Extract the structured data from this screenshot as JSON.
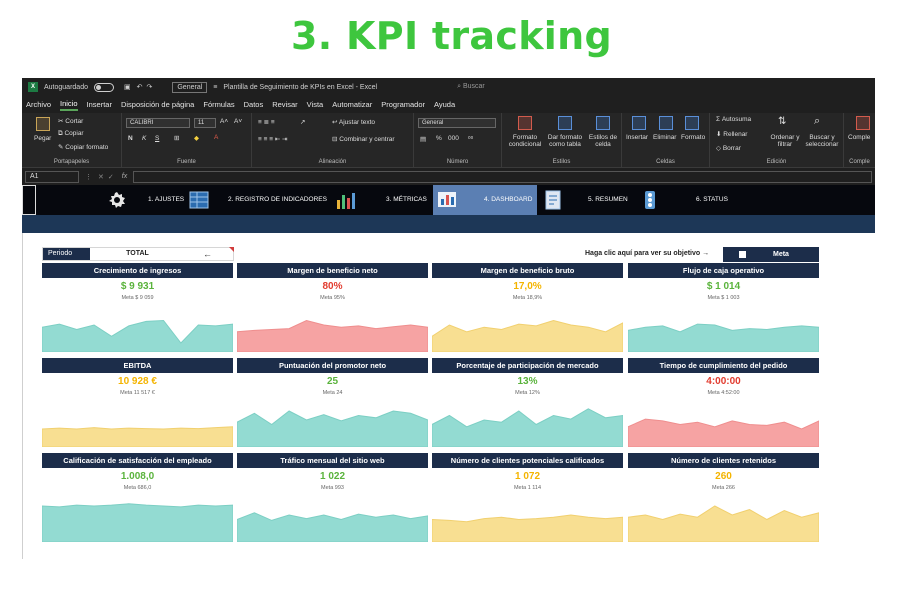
{
  "headline": "3. KPI tracking",
  "colors": {
    "green": "#5ab33c",
    "red": "#e23b2e",
    "orange": "#f4b400",
    "teal_fill": "#93dbd2",
    "pink_fill": "#f6a3a3",
    "yellow_fill": "#f8df92",
    "navy": "#1c2d4a"
  },
  "titlebar": {
    "autosave": "Autoguardado",
    "format": "General",
    "filename": "Plantilla de Seguimiento de KPIs en Excel  -  Excel",
    "search": "Buscar"
  },
  "menu": [
    "Archivo",
    "Inicio",
    "Insertar",
    "Disposición de página",
    "Fórmulas",
    "Datos",
    "Revisar",
    "Vista",
    "Automatizar",
    "Programador",
    "Ayuda"
  ],
  "ribbon": {
    "paste": "Pegar",
    "cut": "Cortar",
    "copy": "Copiar",
    "copy_format": "Copiar formato",
    "clipboard_group": "Portapapeles",
    "font_name": "CALIBRI",
    "font_size": "11",
    "bold": "N",
    "italic": "K",
    "underline": "S",
    "font_group": "Fuente",
    "wrap_text": "Ajustar texto",
    "merge_center": "Combinar y centrar",
    "alignment_group": "Alineación",
    "number_format": "General",
    "percent": "%",
    "thousands": "000",
    "number_group": "Número",
    "cond_format_1": "Formato",
    "cond_format_2": "condicional",
    "table_format_1": "Dar formato",
    "table_format_2": "como tabla",
    "cell_styles_1": "Estilos de",
    "cell_styles_2": "celda",
    "styles_group": "Estilos",
    "insert": "Insertar",
    "delete": "Eliminar",
    "format": "Formato",
    "cells_group": "Celdas",
    "autosum": "Autosuma",
    "fill": "Rellenar",
    "clear": "Borrar",
    "sort_1": "Ordenar y",
    "sort_2": "filtrar",
    "find_1": "Buscar y",
    "find_2": "seleccionar",
    "editing_group": "Edición",
    "complements": "Comple"
  },
  "formula_bar": {
    "cell_ref": "A1",
    "fx": "fx"
  },
  "nav": [
    {
      "label": "1. AJUSTES"
    },
    {
      "label": "2. REGISTRO DE INDICADORES"
    },
    {
      "label": "3. MÉTRICAS"
    },
    {
      "label": "4. DASHBOARD"
    },
    {
      "label": "5. RESUMEN"
    },
    {
      "label": "6. STATUS"
    }
  ],
  "controls": {
    "period_label": "Periodo",
    "period_value": "TOTAL",
    "period_arrow": "←",
    "target_text": "Haga clic aquí para ver su objetivo →",
    "meta_button": "Meta"
  },
  "kpis": [
    {
      "title": "Crecimiento de ingresos",
      "value": "$ 9 931",
      "target": "Meta  $ 9 059",
      "status": "green",
      "fill": "teal",
      "series": [
        0.55,
        0.62,
        0.5,
        0.6,
        0.35,
        0.58,
        0.68,
        0.7,
        0.2,
        0.6,
        0.58,
        0.62
      ]
    },
    {
      "title": "Margen de beneficio neto",
      "value": "80%",
      "target": "Meta  95%",
      "status": "red",
      "fill": "pink",
      "series": [
        0.45,
        0.48,
        0.5,
        0.52,
        0.7,
        0.6,
        0.55,
        0.58,
        0.52,
        0.56,
        0.6,
        0.55
      ]
    },
    {
      "title": "Margen de beneficio bruto",
      "value": "17,0%",
      "target": "Meta  18,9%",
      "status": "orange",
      "fill": "yellow",
      "series": [
        0.35,
        0.6,
        0.45,
        0.55,
        0.5,
        0.62,
        0.58,
        0.7,
        0.6,
        0.55,
        0.45,
        0.65
      ]
    },
    {
      "title": "Flujo de caja operativo",
      "value": "$ 1 014",
      "target": "Meta  $ 1 003",
      "status": "green",
      "fill": "teal",
      "series": [
        0.48,
        0.55,
        0.58,
        0.45,
        0.62,
        0.6,
        0.48,
        0.52,
        0.5,
        0.55,
        0.58,
        0.55
      ]
    },
    {
      "title": "EBITDA",
      "value": "10 928 €",
      "target": "Meta  11 517 €",
      "status": "orange",
      "fill": "yellow",
      "series": [
        0.4,
        0.42,
        0.4,
        0.43,
        0.4,
        0.42,
        0.41,
        0.4,
        0.42,
        0.41,
        0.43,
        0.45
      ]
    },
    {
      "title": "Puntuación del promotor neto",
      "value": "25",
      "target": "Meta  24",
      "status": "green",
      "fill": "teal",
      "series": [
        0.55,
        0.75,
        0.5,
        0.8,
        0.6,
        0.72,
        0.58,
        0.7,
        0.65,
        0.8,
        0.75,
        0.6
      ]
    },
    {
      "title": "Porcentaje de participación de mercado",
      "value": "13%",
      "target": "Meta  12%",
      "status": "green",
      "fill": "teal",
      "series": [
        0.5,
        0.7,
        0.45,
        0.6,
        0.55,
        0.8,
        0.5,
        0.7,
        0.62,
        0.85,
        0.65,
        0.7
      ]
    },
    {
      "title": "Tiempo de cumplimiento del pedido",
      "value": "4:00:00",
      "target": "Meta  4:52:00",
      "status": "red",
      "fill": "pink",
      "series": [
        0.45,
        0.62,
        0.58,
        0.5,
        0.55,
        0.45,
        0.58,
        0.5,
        0.48,
        0.55,
        0.4,
        0.58
      ]
    },
    {
      "title": "Calificación de satisfacción del empleado",
      "value": "1.008,0",
      "target": "Meta  686,0",
      "status": "green",
      "fill": "teal",
      "series": [
        0.8,
        0.78,
        0.82,
        0.8,
        0.82,
        0.85,
        0.82,
        0.8,
        0.78,
        0.82,
        0.8,
        0.82
      ]
    },
    {
      "title": "Tráfico mensual del sitio web",
      "value": "1 022",
      "target": "Meta  993",
      "status": "green",
      "fill": "teal",
      "series": [
        0.5,
        0.65,
        0.48,
        0.6,
        0.52,
        0.6,
        0.5,
        0.62,
        0.55,
        0.6,
        0.52,
        0.58
      ]
    },
    {
      "title": "Número de clientes potenciales calificados",
      "value": "1 072",
      "target": "Meta  1 114",
      "status": "orange",
      "fill": "yellow",
      "series": [
        0.5,
        0.48,
        0.45,
        0.52,
        0.55,
        0.5,
        0.52,
        0.55,
        0.6,
        0.55,
        0.52,
        0.55
      ]
    },
    {
      "title": "Número de clientes retenidos",
      "value": "260",
      "target": "Meta  266",
      "status": "orange",
      "fill": "yellow",
      "series": [
        0.55,
        0.6,
        0.5,
        0.62,
        0.55,
        0.8,
        0.6,
        0.72,
        0.5,
        0.7,
        0.55,
        0.65
      ]
    }
  ]
}
